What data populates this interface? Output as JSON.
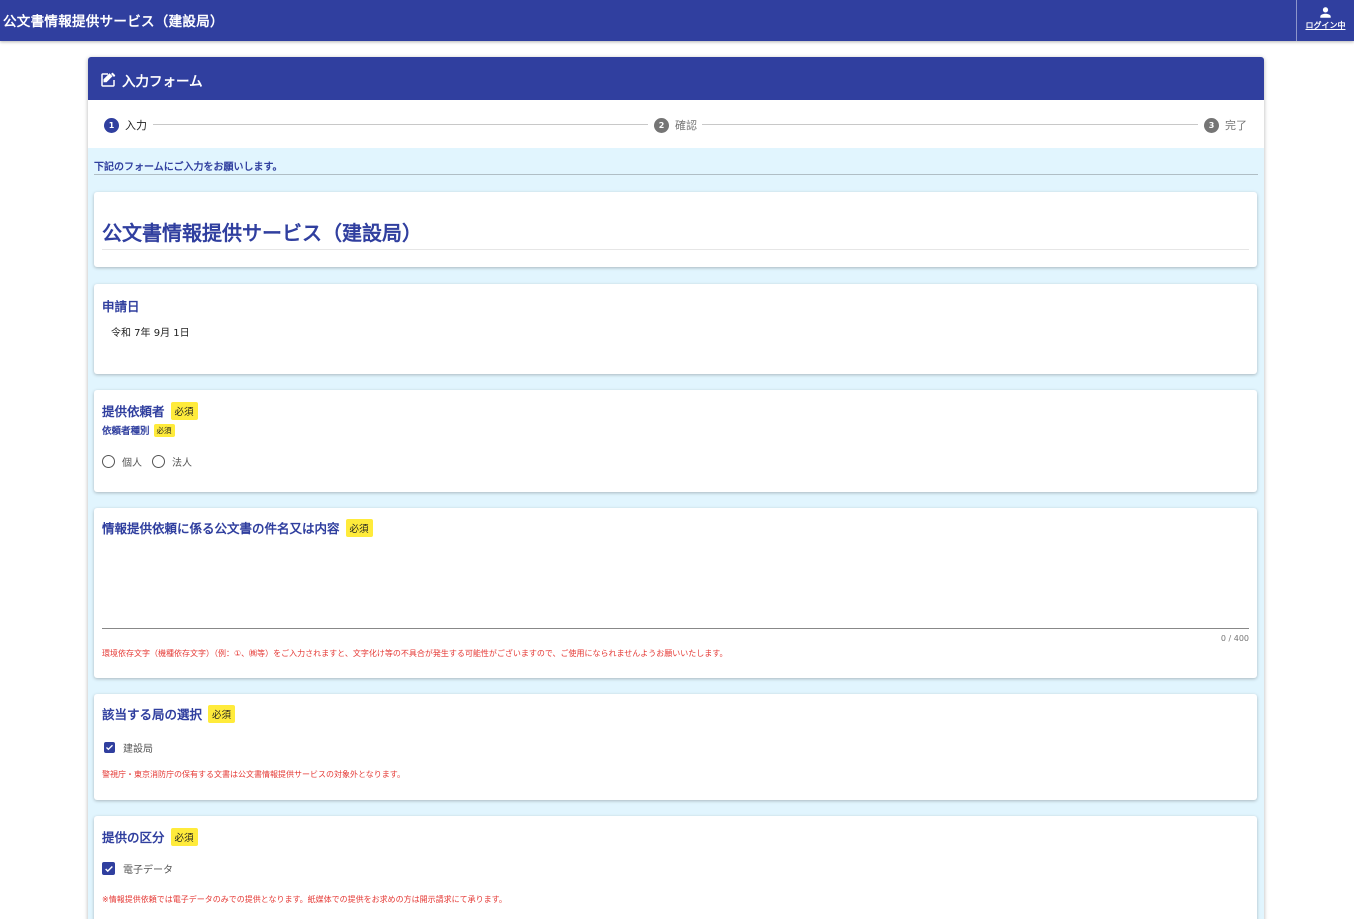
{
  "app": {
    "title": "公文書情報提供サービス（建設局）",
    "login_label": "ログイン中"
  },
  "form": {
    "header_title": "入力フォーム",
    "steps": [
      {
        "num": "1",
        "label": "入力"
      },
      {
        "num": "2",
        "label": "確認"
      },
      {
        "num": "3",
        "label": "完了"
      }
    ],
    "active_step": 1,
    "intro": "下記のフォームにご入力をお願いします。",
    "service_title": "公文書情報提供サービス（建設局）",
    "required_label": "必須",
    "application_date": {
      "label": "申請日",
      "value": "令和 7年 9月 1日"
    },
    "requester": {
      "label": "提供依頼者",
      "type_label": "依頼者種別",
      "options": [
        "個人",
        "法人"
      ]
    },
    "subject": {
      "label": "情報提供依頼に係る公文書の件名又は内容",
      "value": "",
      "counter": "0 / 400",
      "warning": "環境依存文字（機種依存文字）（例：①、㈱等）をご入力されますと、文字化け等の不具合が発生する可能性がございますので、ご使用になられませんようお願いいたします。"
    },
    "bureau": {
      "label": "該当する局の選択",
      "option": "建設局",
      "checked": true,
      "note": "警視庁・東京消防庁の保有する文書は公文書情報提供サービスの対象外となります。"
    },
    "provision": {
      "label": "提供の区分",
      "option": "電子データ",
      "checked": true,
      "note": "※情報提供依頼では電子データのみでの提供となります。紙媒体での提供をお求めの方は開示請求にて承ります。"
    }
  },
  "colors": {
    "primary": "#303f9f",
    "background": "#e1f5fe",
    "required_badge": "#ffeb3b",
    "warning": "#e53935"
  }
}
